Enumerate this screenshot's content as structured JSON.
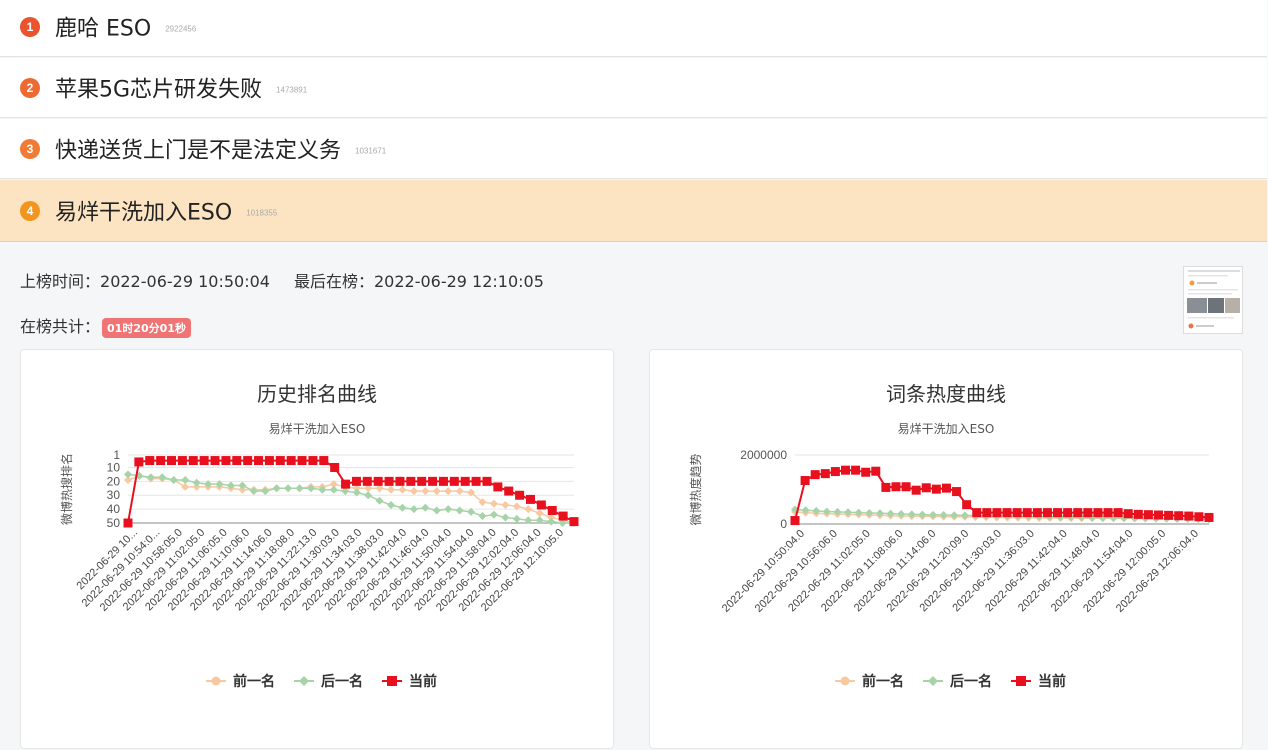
{
  "list": [
    {
      "rank": "1",
      "title": "鹿哈 ESO",
      "count": "2922456",
      "badge_color": "#e9532e"
    },
    {
      "rank": "2",
      "title": "苹果5G芯片研发失败",
      "count": "1473891",
      "badge_color": "#ed6a35"
    },
    {
      "rank": "3",
      "title": "快递送货上门是不是法定义务",
      "count": "1031671",
      "badge_color": "#ef7b34"
    },
    {
      "rank": "4",
      "title": "易烊干洗加入ESO",
      "count": "1018355",
      "badge_color": "#f2951f"
    }
  ],
  "detail": {
    "onboard_label": "上榜时间：",
    "onboard_time": "2022-06-29 10:50:04",
    "last_label": "最后在榜：",
    "last_time": "2022-06-29 12:10:05",
    "total_label": "在榜共计：",
    "total_duration": "01时20分01秒"
  },
  "colors": {
    "prev": "#f8c9a0",
    "next": "#a6d4a8",
    "current": "#e8101e",
    "active_row": "#fce4c3",
    "duration_badge": "#f07474"
  },
  "chart_data": [
    {
      "type": "line",
      "title": "历史排名曲线",
      "subtitle": "易烊干洗加入ESO",
      "ylabel": "微博热搜排名",
      "y_ticks": [
        "1",
        "10",
        "20",
        "30",
        "40",
        "50"
      ],
      "ylim": [
        50,
        1
      ],
      "y_inverted": true,
      "x_ticks": [
        "2022-06-29 10...",
        "2022-06-29 10:54:0...",
        "2022-06-29 10:58:05.0",
        "2022-06-29 11:02:05.0",
        "2022-06-29 11:06:05.0",
        "2022-06-29 11:10:06.0",
        "2022-06-29 11:14:06.0",
        "2022-06-29 11:18:08.0",
        "2022-06-29 11:22:13.0",
        "2022-06-29 11:30:03.0",
        "2022-06-29 11:34:03.0",
        "2022-06-29 11:38:03.0",
        "2022-06-29 11:42:04.0",
        "2022-06-29 11:46:04.0",
        "2022-06-29 11:50:04.0",
        "2022-06-29 11:54:04.0",
        "2022-06-29 11:58:04.0",
        "2022-06-29 12:02:04.0",
        "2022-06-29 12:06:04.0",
        "2022-06-29 12:10:05.0"
      ],
      "legend": [
        "前一名",
        "后一名",
        "当前"
      ],
      "legend_position": "bottom",
      "grid": true,
      "series": [
        {
          "name": "前一名",
          "values": [
            19,
            16,
            18,
            18,
            19,
            24,
            24,
            24,
            24,
            25,
            26,
            26,
            26,
            25,
            25,
            25,
            24,
            24,
            22,
            24,
            25,
            25,
            25,
            26,
            26,
            27,
            27,
            27,
            27,
            27,
            28,
            35,
            36,
            37,
            38,
            40,
            43,
            46,
            48,
            50
          ]
        },
        {
          "name": "后一名",
          "values": [
            15,
            16,
            17,
            17,
            19,
            19,
            21,
            22,
            22,
            23,
            23,
            27,
            27,
            25,
            25,
            25,
            25,
            26,
            26,
            27,
            28,
            30,
            34,
            37,
            39,
            40,
            39,
            41,
            40,
            41,
            42,
            45,
            44,
            46,
            47,
            48,
            48,
            49,
            50,
            50
          ]
        },
        {
          "name": "当前",
          "values": [
            50,
            6,
            5,
            5,
            5,
            5,
            5,
            5,
            5,
            5,
            5,
            5,
            5,
            5,
            5,
            5,
            5,
            5,
            5,
            10,
            22,
            20,
            20,
            20,
            20,
            20,
            20,
            20,
            20,
            20,
            20,
            20,
            20,
            20,
            24,
            27,
            30,
            33,
            37,
            41,
            45,
            49
          ]
        }
      ]
    },
    {
      "type": "line",
      "title": "词条热度曲线",
      "subtitle": "易烊干洗加入ESO",
      "ylabel": "微博热度趋势",
      "y_ticks": [
        "0",
        "2000000"
      ],
      "ylim": [
        0,
        2000000
      ],
      "x_ticks": [
        "2022-06-29 10:50:04.0",
        "2022-06-29 10:56:06.0",
        "2022-06-29 11:02:05.0",
        "2022-06-29 11:08:06.0",
        "2022-06-29 11:14:06.0",
        "2022-06-29 11:20:09.0",
        "2022-06-29 11:30:03.0",
        "2022-06-29 11:36:03.0",
        "2022-06-29 11:42:04.0",
        "2022-06-29 11:48:04.0",
        "2022-06-29 11:54:04.0",
        "2022-06-29 12:00:05.0",
        "2022-06-29 12:06:04.0"
      ],
      "legend": [
        "前一名",
        "后一名",
        "当前"
      ],
      "legend_position": "bottom",
      "grid": true,
      "series": [
        {
          "name": "前一名",
          "values": [
            350000,
            330000,
            310000,
            300000,
            290000,
            280000,
            270000,
            260000,
            250000,
            240000,
            235000,
            230000,
            225000,
            220000,
            215000,
            210000,
            205000,
            200000,
            195000,
            190000,
            185000,
            180000,
            178000,
            176000,
            174000,
            172000,
            170000,
            168000,
            166000,
            164000,
            162000,
            160000,
            158000,
            156000,
            154000,
            152000,
            150000,
            148000,
            146000,
            144000
          ]
        },
        {
          "name": "后一名",
          "values": [
            420000,
            400000,
            380000,
            360000,
            350000,
            340000,
            330000,
            320000,
            310000,
            300000,
            290000,
            280000,
            270000,
            265000,
            260000,
            255000,
            250000,
            245000,
            240000,
            235000,
            230000,
            225000,
            220000,
            215000,
            210000,
            205000,
            200000,
            195000,
            190000,
            185000,
            180000,
            175000,
            170000,
            165000,
            160000,
            155000,
            150000,
            145000,
            140000,
            135000
          ]
        },
        {
          "name": "当前",
          "values": [
            100000,
            1260000,
            1430000,
            1460000,
            1520000,
            1560000,
            1560000,
            1500000,
            1530000,
            1060000,
            1080000,
            1080000,
            980000,
            1050000,
            1010000,
            1040000,
            940000,
            560000,
            330000,
            330000,
            330000,
            330000,
            330000,
            330000,
            330000,
            330000,
            330000,
            330000,
            330000,
            330000,
            330000,
            330000,
            330000,
            300000,
            280000,
            270000,
            260000,
            250000,
            240000,
            230000,
            210000,
            190000
          ]
        }
      ]
    }
  ]
}
